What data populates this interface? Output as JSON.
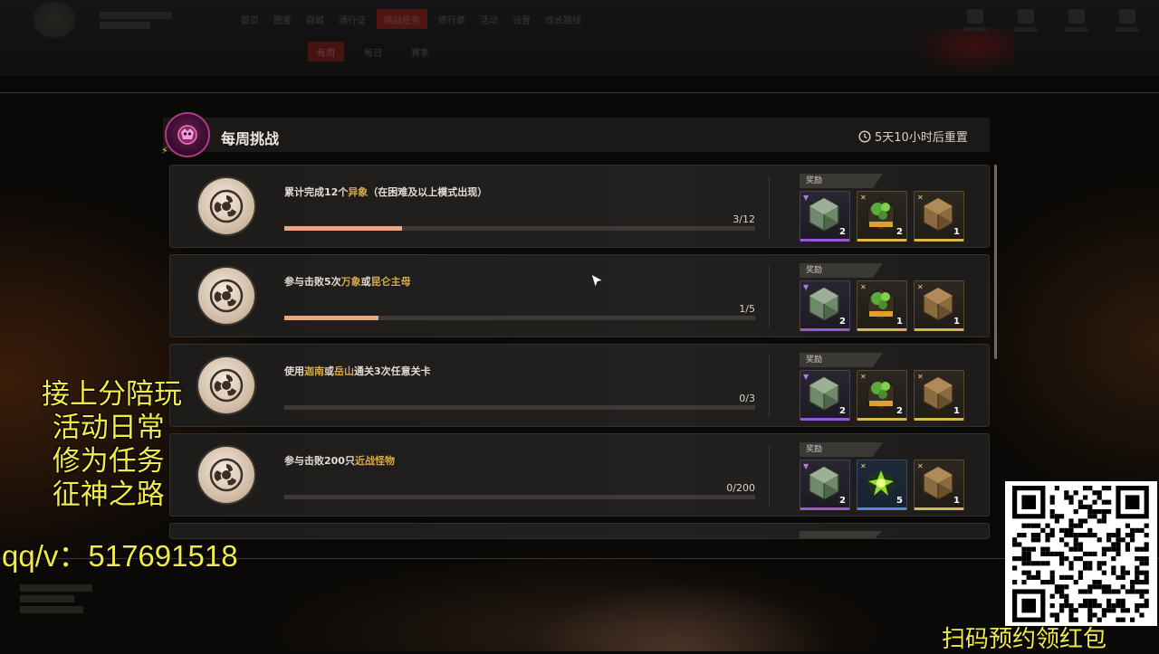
{
  "top_nav": {
    "items": [
      "首页",
      "图鉴",
      "商城",
      "通行证",
      "挑战任务",
      "修行录",
      "活动",
      "设置",
      "成长路线"
    ],
    "active_index": 4,
    "sub_items": [
      "每周",
      "每日",
      "赛季"
    ],
    "sub_active_index": 0
  },
  "panel": {
    "title": "每周挑战",
    "reset": "5天10小时后重置"
  },
  "reward_label": "奖励",
  "tasks": [
    {
      "parts": [
        "累计完成12个",
        "异象",
        "（在困难及以上模式出现）"
      ],
      "progress_text": "3/12",
      "progress_value": 3,
      "progress_max": 12,
      "rewards": [
        {
          "icon": "jade-gem-icon",
          "rarity": "purple",
          "qty": "2"
        },
        {
          "icon": "green-ore-icon",
          "rarity": "gold",
          "qty": "2"
        },
        {
          "icon": "bronze-gem-icon",
          "rarity": "gold",
          "qty": "1"
        }
      ]
    },
    {
      "parts": [
        "参与击败5次",
        "万象",
        "或",
        "昆仑主母",
        ""
      ],
      "progress_text": "1/5",
      "progress_value": 1,
      "progress_max": 5,
      "rewards": [
        {
          "icon": "jade-gem-icon",
          "rarity": "purple",
          "qty": "2"
        },
        {
          "icon": "green-ore-icon",
          "rarity": "gold",
          "qty": "1"
        },
        {
          "icon": "bronze-gem-icon",
          "rarity": "gold",
          "qty": "1"
        }
      ]
    },
    {
      "parts": [
        "使用",
        "迦南",
        "或",
        "岳山",
        "通关3次任意关卡"
      ],
      "progress_text": "0/3",
      "progress_value": 0,
      "progress_max": 3,
      "rewards": [
        {
          "icon": "jade-gem-icon",
          "rarity": "purple",
          "qty": "2"
        },
        {
          "icon": "green-ore-icon",
          "rarity": "gold",
          "qty": "2"
        },
        {
          "icon": "bronze-gem-icon",
          "rarity": "gold",
          "qty": "1"
        }
      ]
    },
    {
      "parts": [
        "参与击败200只",
        "近战怪物",
        ""
      ],
      "progress_text": "0/200",
      "progress_value": 0,
      "progress_max": 200,
      "rewards": [
        {
          "icon": "jade-gem-icon",
          "rarity": "purple",
          "qty": "2"
        },
        {
          "icon": "green-energy-icon",
          "rarity": "blue",
          "qty": "5"
        },
        {
          "icon": "bronze-gem-icon",
          "rarity": "gold",
          "qty": "1"
        }
      ]
    }
  ],
  "overlay": {
    "lines": [
      "接上分陪玩",
      "  活动日常",
      "  修为任务",
      "  征神之路"
    ],
    "contact": "qq/v：517691518",
    "qr_caption": "扫码预约领红包"
  },
  "colors": {
    "highlight": "#d8a84e",
    "progress": "#e7a883",
    "overlay_text": "#f2ea48",
    "rarity_purple": "#9a5ad8",
    "rarity_gold": "#e2b44c",
    "rarity_blue": "#4f8ae0"
  }
}
